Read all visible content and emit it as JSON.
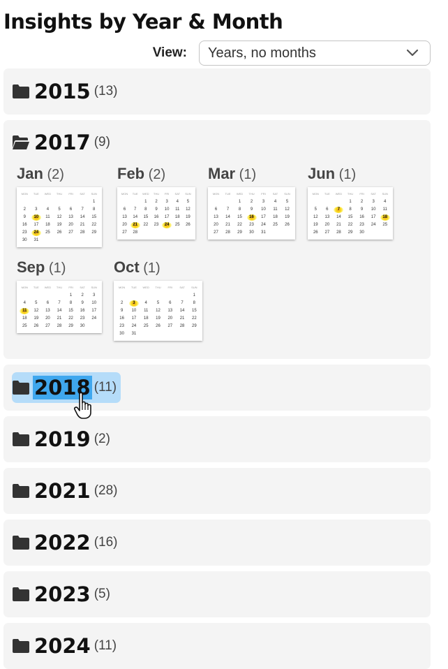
{
  "page_title": "Insights by Year & Month",
  "view": {
    "label": "View:",
    "selected": "Years, no months"
  },
  "weekday_headers": [
    "MON",
    "TUE",
    "WED",
    "THU",
    "FRI",
    "SAT",
    "SUN"
  ],
  "years": [
    {
      "year": "2015",
      "count": "(13)",
      "expanded": false,
      "highlighted": false
    },
    {
      "year": "2017",
      "count": "(9)",
      "expanded": true,
      "highlighted": false,
      "months": [
        {
          "name": "Jan",
          "count": "(2)",
          "offset": 6,
          "days": 31,
          "highlight_days": [
            10,
            24
          ]
        },
        {
          "name": "Feb",
          "count": "(2)",
          "offset": 2,
          "days": 28,
          "highlight_days": [
            21,
            24
          ]
        },
        {
          "name": "Mar",
          "count": "(1)",
          "offset": 2,
          "days": 31,
          "highlight_days": [
            16
          ]
        },
        {
          "name": "Jun",
          "count": "(1)",
          "offset": 3,
          "days": 30,
          "highlight_days": [
            7,
            18
          ]
        },
        {
          "name": "Sep",
          "count": "(1)",
          "offset": 4,
          "days": 30,
          "highlight_days": [
            11
          ]
        },
        {
          "name": "Oct",
          "count": "(1)",
          "offset": 6,
          "days": 31,
          "highlight_days": [
            3
          ]
        }
      ]
    },
    {
      "year": "2018",
      "count": "(11)",
      "expanded": false,
      "highlighted": true
    },
    {
      "year": "2019",
      "count": "(2)",
      "expanded": false,
      "highlighted": false
    },
    {
      "year": "2021",
      "count": "(28)",
      "expanded": false,
      "highlighted": false
    },
    {
      "year": "2022",
      "count": "(16)",
      "expanded": false,
      "highlighted": false
    },
    {
      "year": "2023",
      "count": "(5)",
      "expanded": false,
      "highlighted": false
    },
    {
      "year": "2024",
      "count": "(11)",
      "expanded": false,
      "highlighted": false
    }
  ]
}
